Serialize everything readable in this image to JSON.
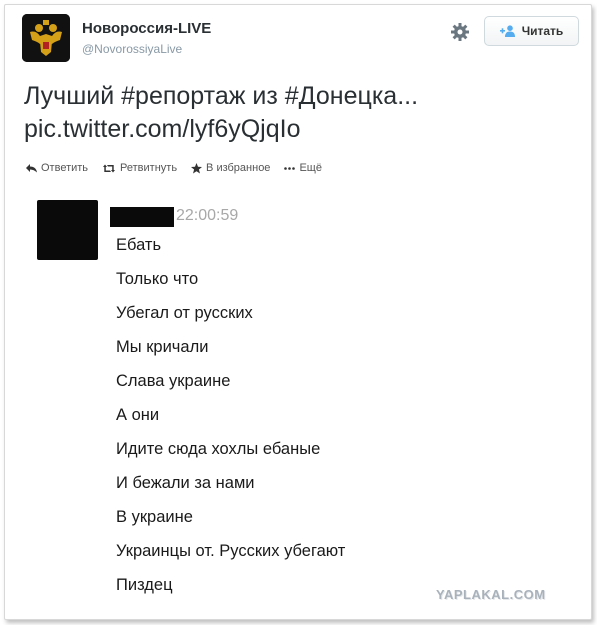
{
  "header": {
    "display_name": "Новороссия-LIVE",
    "screen_name": "@NovorossiyaLive",
    "follow_label": "Читать",
    "icons": {
      "avatar": "double-headed-eagle-icon",
      "settings": "gear-icon",
      "follow": "add-user-icon"
    }
  },
  "tweet": {
    "line1": "Лучший #репортаж из #Донецка...",
    "line2": "pic.twitter.com/lyf6yQjqIo"
  },
  "actions": {
    "reply": "Ответить",
    "retweet": "Ретвитнуть",
    "favorite": "В избранное",
    "more": "Ещё"
  },
  "embedded_chat": {
    "time": "22:00:59",
    "messages": [
      "Ебать",
      "Только что",
      "Убегал от русских",
      "Мы кричали",
      "Слава украине",
      "А они",
      "Идите сюда хохлы ебаные",
      "И бежали за нами",
      "В украине",
      "Украинцы от. Русских убегают",
      "Пиздец"
    ]
  },
  "watermark": "YAPLAKAL.COM",
  "colors": {
    "text": "#292f33",
    "muted": "#8899a6",
    "follow_icon": "#55acee",
    "eagle_gold": "#d4a017"
  }
}
